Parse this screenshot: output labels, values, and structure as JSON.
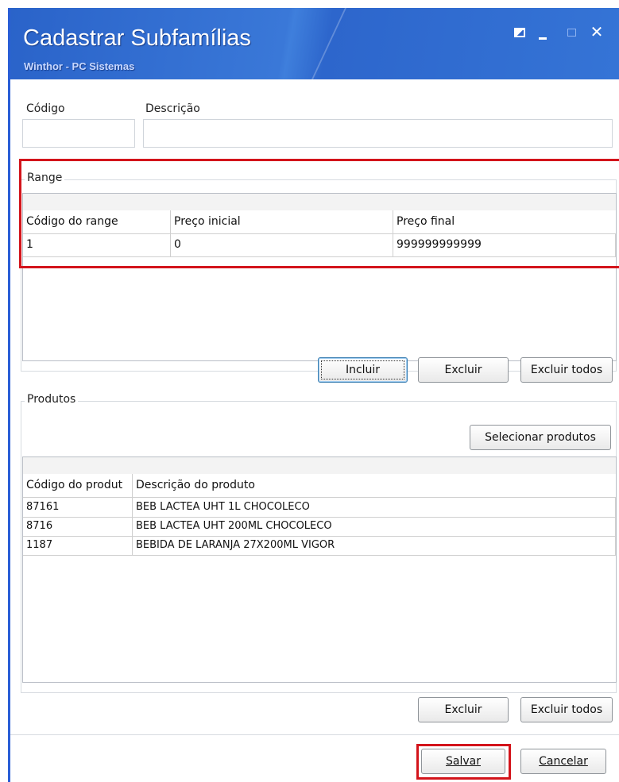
{
  "window": {
    "title": "Cadastrar Subfamílias",
    "subtitle": "Winthor - PC Sistemas",
    "controls": [
      "restore-icon",
      "minimize-icon",
      "maximize-icon",
      "close-icon"
    ],
    "close_glyph": "✕",
    "accent_color": "#2a63c9",
    "highlight_color": "#d3141b"
  },
  "fields": {
    "codigo_label": "Código",
    "codigo_value": "",
    "descricao_label": "Descrição",
    "descricao_value": ""
  },
  "range": {
    "group_label": "Range",
    "columns": [
      "Código do range",
      "Preço inicial",
      "Preço final"
    ],
    "rows": [
      [
        "1",
        "0",
        "999999999999"
      ]
    ],
    "buttons": {
      "incluir": "Incluir",
      "excluir": "Excluir",
      "excluir_todos": "Excluir todos"
    }
  },
  "produtos": {
    "group_label": "Produtos",
    "select_button": "Selecionar produtos",
    "columns": [
      "Código do produt",
      "Descrição do produto"
    ],
    "rows": [
      [
        "87161",
        "BEB LACTEA UHT 1L CHOCOLECO"
      ],
      [
        "8716",
        "BEB LACTEA UHT 200ML CHOCOLECO"
      ],
      [
        "1187",
        "BEBIDA DE LARANJA 27X200ML VIGOR"
      ]
    ],
    "buttons": {
      "excluir": "Excluir",
      "excluir_todos": "Excluir todos"
    }
  },
  "footer": {
    "salvar": "Salvar",
    "cancelar": "Cancelar"
  }
}
